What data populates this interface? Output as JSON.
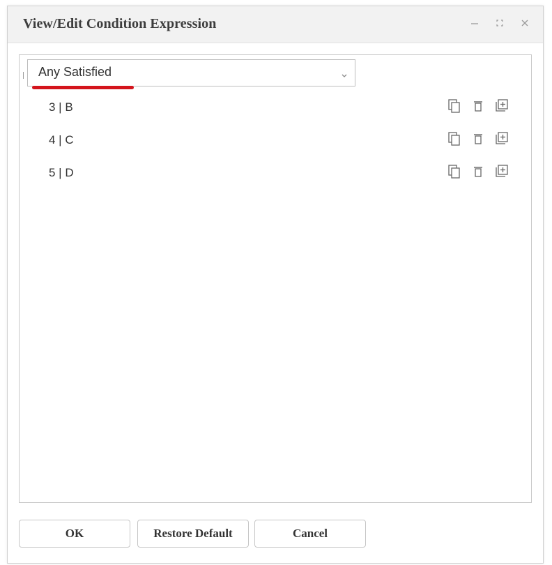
{
  "dialog": {
    "title": "View/Edit Condition Expression"
  },
  "window_controls": [
    "minimize-icon",
    "maximize-icon",
    "close-icon"
  ],
  "condition_select": {
    "selected": "Any Satisfied",
    "annotation_color": "#d4141c"
  },
  "conditions": [
    {
      "label": "3 | B"
    },
    {
      "label": "4 | C"
    },
    {
      "label": "5 | D"
    }
  ],
  "row_actions": [
    "copy-icon",
    "delete-icon",
    "add-icon"
  ],
  "footer": {
    "ok": "OK",
    "restore_default": "Restore Default",
    "cancel": "Cancel"
  }
}
